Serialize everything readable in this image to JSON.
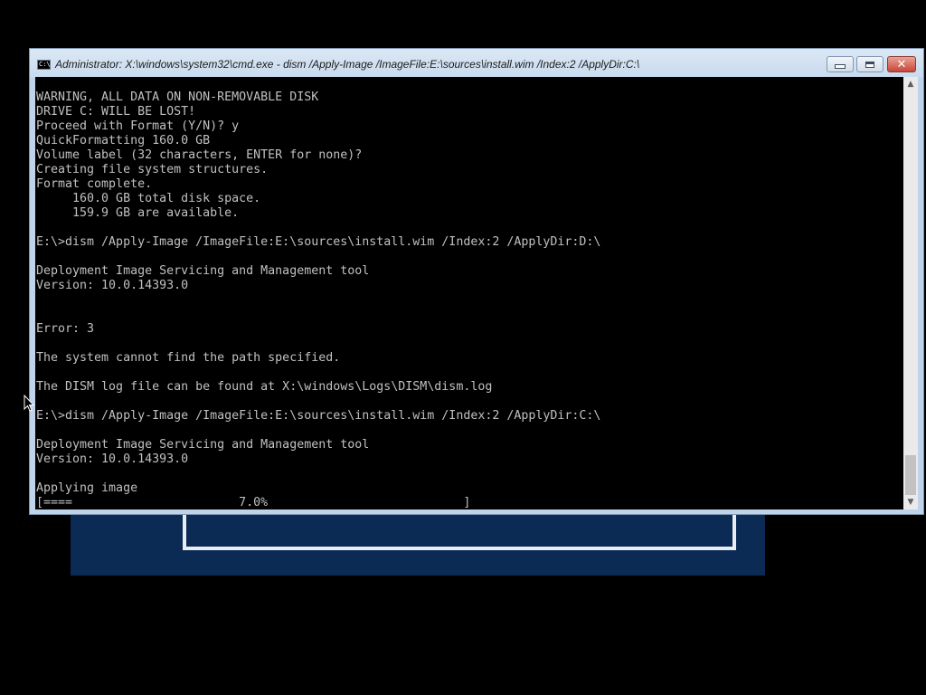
{
  "window": {
    "title": "Administrator: X:\\windows\\system32\\cmd.exe - dism  /Apply-Image /ImageFile:E:\\sources\\install.wim /Index:2 /ApplyDir:C:\\",
    "icon": "cmd-icon",
    "icon_text": "C:\\",
    "buttons": {
      "minimize": "minimize-icon",
      "maximize": "maximize-icon",
      "close_label": "✕"
    }
  },
  "console": {
    "text": "WARNING, ALL DATA ON NON-REMOVABLE DISK\nDRIVE C: WILL BE LOST!\nProceed with Format (Y/N)? y\nQuickFormatting 160.0 GB\nVolume label (32 characters, ENTER for none)?\nCreating file system structures.\nFormat complete.\n     160.0 GB total disk space.\n     159.9 GB are available.\n\nE:\\>dism /Apply-Image /ImageFile:E:\\sources\\install.wim /Index:2 /ApplyDir:D:\\\n\nDeployment Image Servicing and Management tool\nVersion: 10.0.14393.0\n\n\nError: 3\n\nThe system cannot find the path specified.\n\nThe DISM log file can be found at X:\\windows\\Logs\\DISM\\dism.log\n\nE:\\>dism /Apply-Image /ImageFile:E:\\sources\\install.wim /Index:2 /ApplyDir:C:\\\n\nDeployment Image Servicing and Management tool\nVersion: 10.0.14393.0\n\nApplying image\n[====                       7.0%                           ]",
    "progress_percent": 7.0
  },
  "scrollbar": {
    "up_arrow": "▲",
    "down_arrow": "▼"
  },
  "colors": {
    "console_bg": "#000000",
    "console_fg": "#c0c0c0",
    "setup_bg": "#0b2a54"
  }
}
